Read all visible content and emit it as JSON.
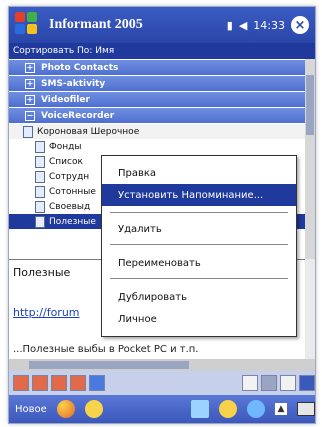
{
  "title_bar": {
    "app_title": "Informant 2005",
    "time": "14:33",
    "close_label": "×"
  },
  "sort_row": {
    "label": "Сортировать По: Имя"
  },
  "categories": [
    {
      "label": "Photo Contacts"
    },
    {
      "label": "SMS-aktivity"
    },
    {
      "label": "Videofiler"
    },
    {
      "label": "VoiceRecorder"
    }
  ],
  "items": [
    {
      "label": "Короновая Шерочное",
      "selected": false,
      "head": true
    },
    {
      "label": "Фонды",
      "selected": false
    },
    {
      "label": "Список",
      "selected": false
    },
    {
      "label": "Сотрудн",
      "selected": false
    },
    {
      "label": "Сотонные",
      "selected": false
    },
    {
      "label": "Своевыд",
      "selected": false
    },
    {
      "label": "Полезные",
      "selected": true
    }
  ],
  "context_menu": [
    {
      "label": "Правка",
      "active": false
    },
    {
      "label": "Установить Напоминание...",
      "active": true
    },
    {
      "label": "Удалить",
      "active": false
    },
    {
      "label": "Переименовать",
      "active": false
    },
    {
      "label": "Дублировать",
      "active": false
    },
    {
      "label": "Личное",
      "active": false
    }
  ],
  "note": {
    "text": "Полезные",
    "link": "http://forum",
    "bottom": "...Полезные выбы в Pocket PC и т.п."
  },
  "menu_bar": {
    "new_label": "Новое"
  },
  "colors": {
    "accent": "#1f3a9c",
    "titlebar": "#3b5cc4",
    "menubar": "#3b58bb"
  }
}
